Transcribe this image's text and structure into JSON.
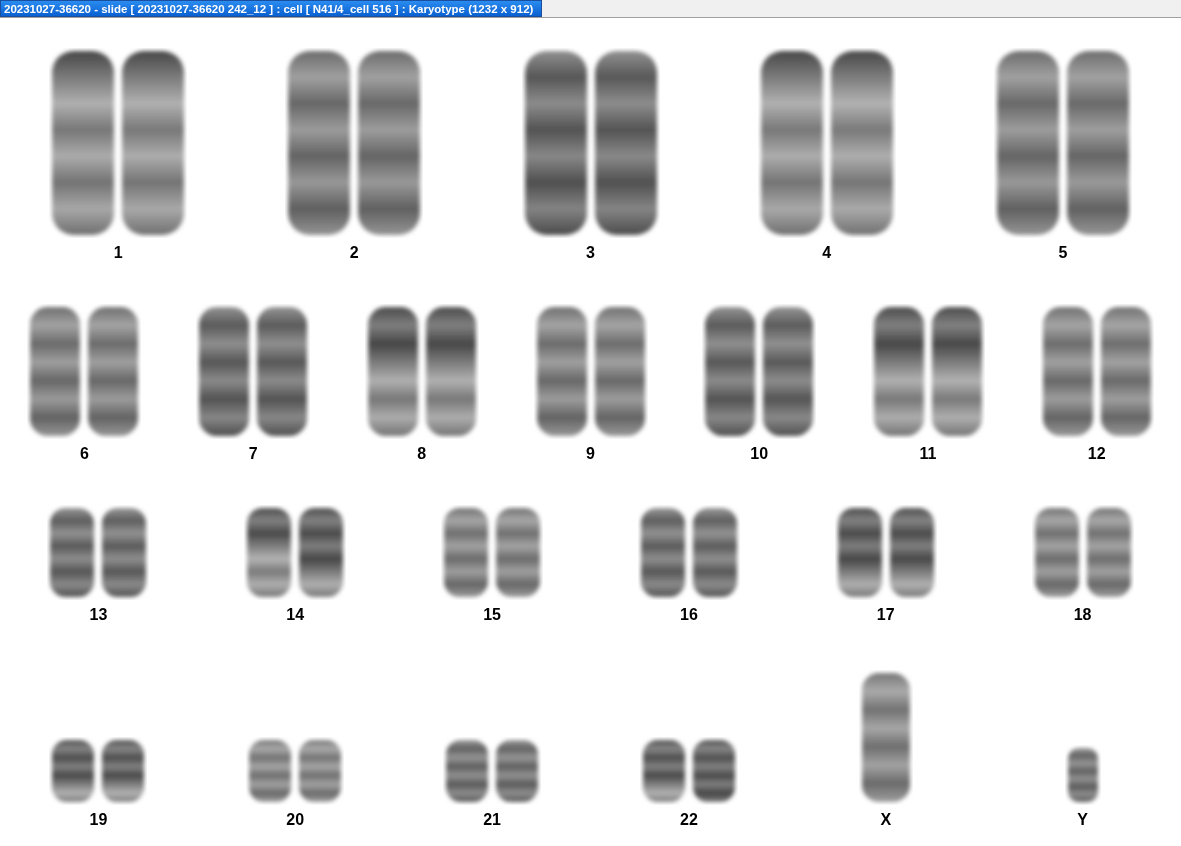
{
  "window": {
    "title": "20231027-36620 - slide [ 20231027-36620 242_12 ] : cell [ N41/4_cell 516 ] : Karyotype  (1232 x 912)"
  },
  "rows": [
    {
      "items": [
        {
          "label": "1",
          "kind": "pair"
        },
        {
          "label": "2",
          "kind": "pair"
        },
        {
          "label": "3",
          "kind": "pair"
        },
        {
          "label": "4",
          "kind": "pair"
        },
        {
          "label": "5",
          "kind": "pair"
        }
      ]
    },
    {
      "items": [
        {
          "label": "6",
          "kind": "pair"
        },
        {
          "label": "7",
          "kind": "pair"
        },
        {
          "label": "8",
          "kind": "pair"
        },
        {
          "label": "9",
          "kind": "pair"
        },
        {
          "label": "10",
          "kind": "pair"
        },
        {
          "label": "11",
          "kind": "pair"
        },
        {
          "label": "12",
          "kind": "pair"
        }
      ]
    },
    {
      "items": [
        {
          "label": "13",
          "kind": "pair"
        },
        {
          "label": "14",
          "kind": "pair"
        },
        {
          "label": "15",
          "kind": "pair"
        },
        {
          "label": "16",
          "kind": "pair"
        },
        {
          "label": "17",
          "kind": "pair"
        },
        {
          "label": "18",
          "kind": "pair"
        }
      ]
    },
    {
      "items": [
        {
          "label": "19",
          "kind": "pair"
        },
        {
          "label": "20",
          "kind": "pair"
        },
        {
          "label": "21",
          "kind": "pair"
        },
        {
          "label": "22",
          "kind": "pair"
        },
        {
          "label": "X",
          "kind": "single"
        },
        {
          "label": "Y",
          "kind": "single"
        }
      ]
    }
  ]
}
